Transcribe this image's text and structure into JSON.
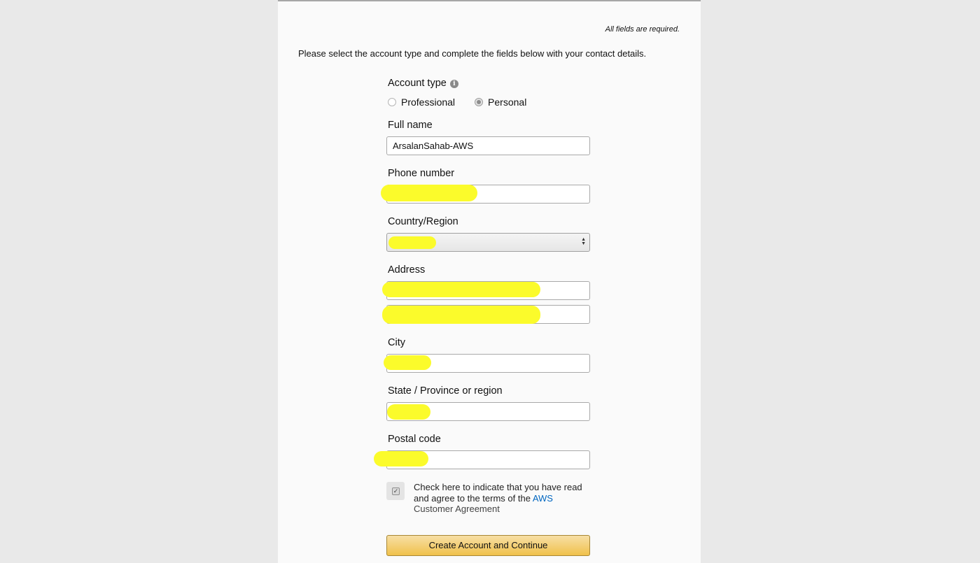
{
  "header": {
    "required_note": "All fields are required.",
    "intro": "Please select the account type and complete the fields below with your contact details."
  },
  "account_type": {
    "label": "Account type",
    "info_icon": "info-icon",
    "options": [
      {
        "label": "Professional",
        "selected": false
      },
      {
        "label": "Personal",
        "selected": true
      }
    ]
  },
  "fields": {
    "full_name": {
      "label": "Full name",
      "value": "ArsalanSahab-AWS"
    },
    "phone": {
      "label": "Phone number",
      "value": ""
    },
    "country": {
      "label": "Country/Region",
      "value": ""
    },
    "address": {
      "label": "Address",
      "line1": "",
      "line2": ""
    },
    "city": {
      "label": "City",
      "value": ""
    },
    "state": {
      "label": "State / Province or region",
      "value": ""
    },
    "postal": {
      "label": "Postal code",
      "value": ""
    }
  },
  "agreement": {
    "checked": true,
    "text": "Check here to indicate that you have read and agree to the terms of the",
    "link_part1": "AWS",
    "link_part2": "Customer Agreement"
  },
  "submit": {
    "label": "Create Account and Continue"
  },
  "colors": {
    "redaction": "#fbfb2b",
    "link": "#0066c0",
    "button_top": "#f7dfa5",
    "button_bottom": "#f0c14b"
  }
}
